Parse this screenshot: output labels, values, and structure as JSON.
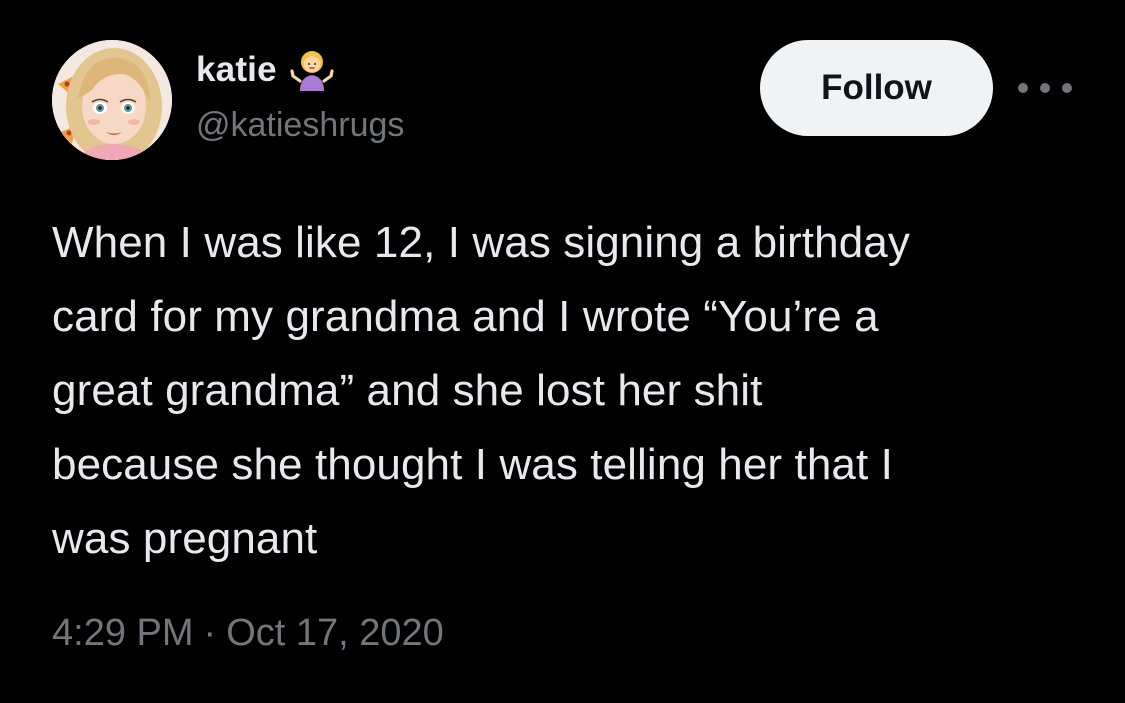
{
  "user": {
    "display_name": "katie",
    "handle": "@katieshrugs",
    "name_emoji": "person-shrugging-emoji",
    "avatar": "avatar-cartoon-woman"
  },
  "actions": {
    "follow_label": "Follow",
    "more_icon": "more-horizontal-icon"
  },
  "tweet": {
    "text": "When I was like 12, I was signing a birthday\ncard for my grandma and I wrote “You’re a\ngreat grandma” and she lost her shit\nbecause she thought I was telling her that I\nwas pregnant",
    "time": "4:29 PM",
    "separator": "·",
    "date": "Oct 17, 2020"
  },
  "colors": {
    "background": "#000000",
    "text_primary": "#e7e9ea",
    "text_secondary": "#71767b",
    "follow_bg": "#eff3f4",
    "follow_text": "#0f1419"
  }
}
